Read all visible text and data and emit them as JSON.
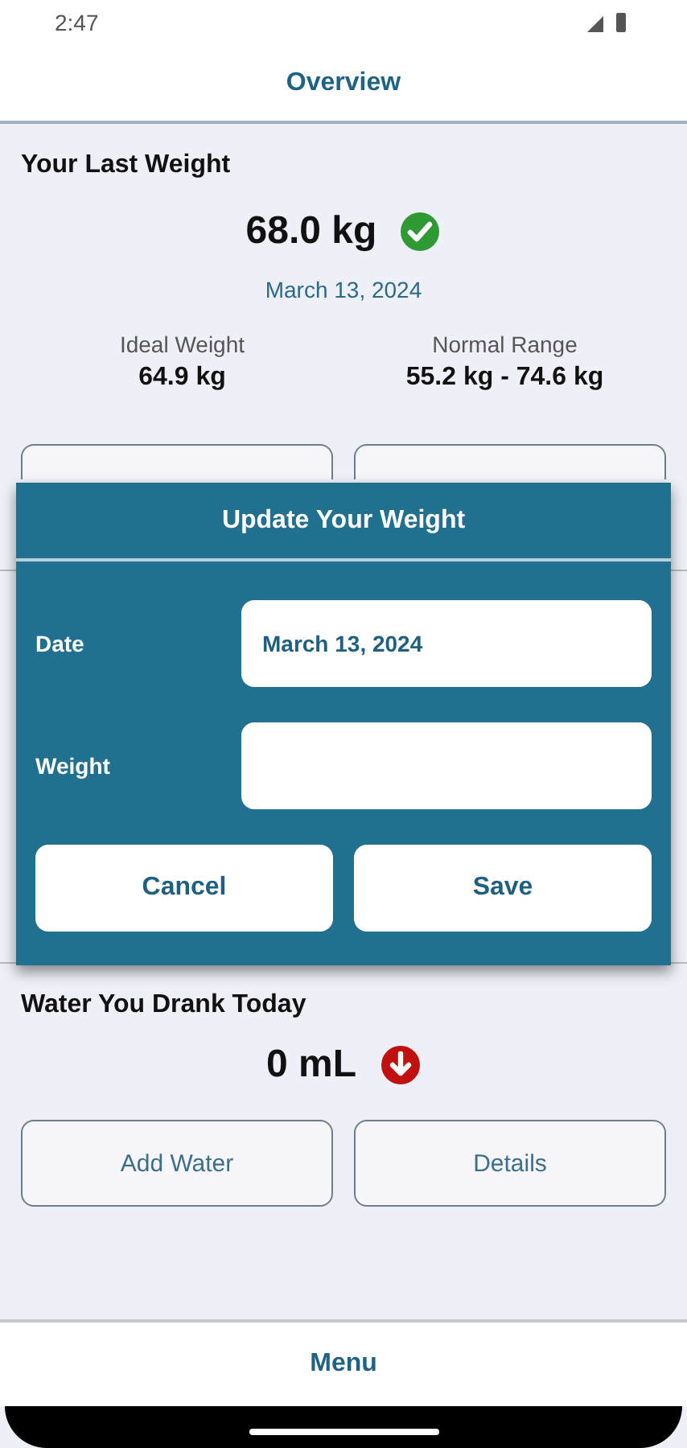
{
  "status_bar": {
    "time": "2:47"
  },
  "header": {
    "title": "Overview"
  },
  "weight": {
    "title": "Your Last Weight",
    "value": "68.0 kg",
    "kind": "ok",
    "date": "March 13, 2024",
    "stats": [
      {
        "label": "Ideal Weight",
        "value": "64.9 kg"
      },
      {
        "label": "Normal Range",
        "value": "55.2 kg - 74.6 kg"
      }
    ]
  },
  "dialog": {
    "title": "Update Your Weight",
    "fields": [
      {
        "label": "Date",
        "value": "March 13, 2024"
      },
      {
        "label": "Weight"
      }
    ],
    "buttons": [
      "Cancel",
      "Save"
    ]
  },
  "water": {
    "title": "Water You Drank Today",
    "value": "0 mL",
    "kind": "low",
    "buttons": [
      "Add Water",
      "Details"
    ]
  },
  "bottom_bar": {
    "label": "Menu"
  }
}
